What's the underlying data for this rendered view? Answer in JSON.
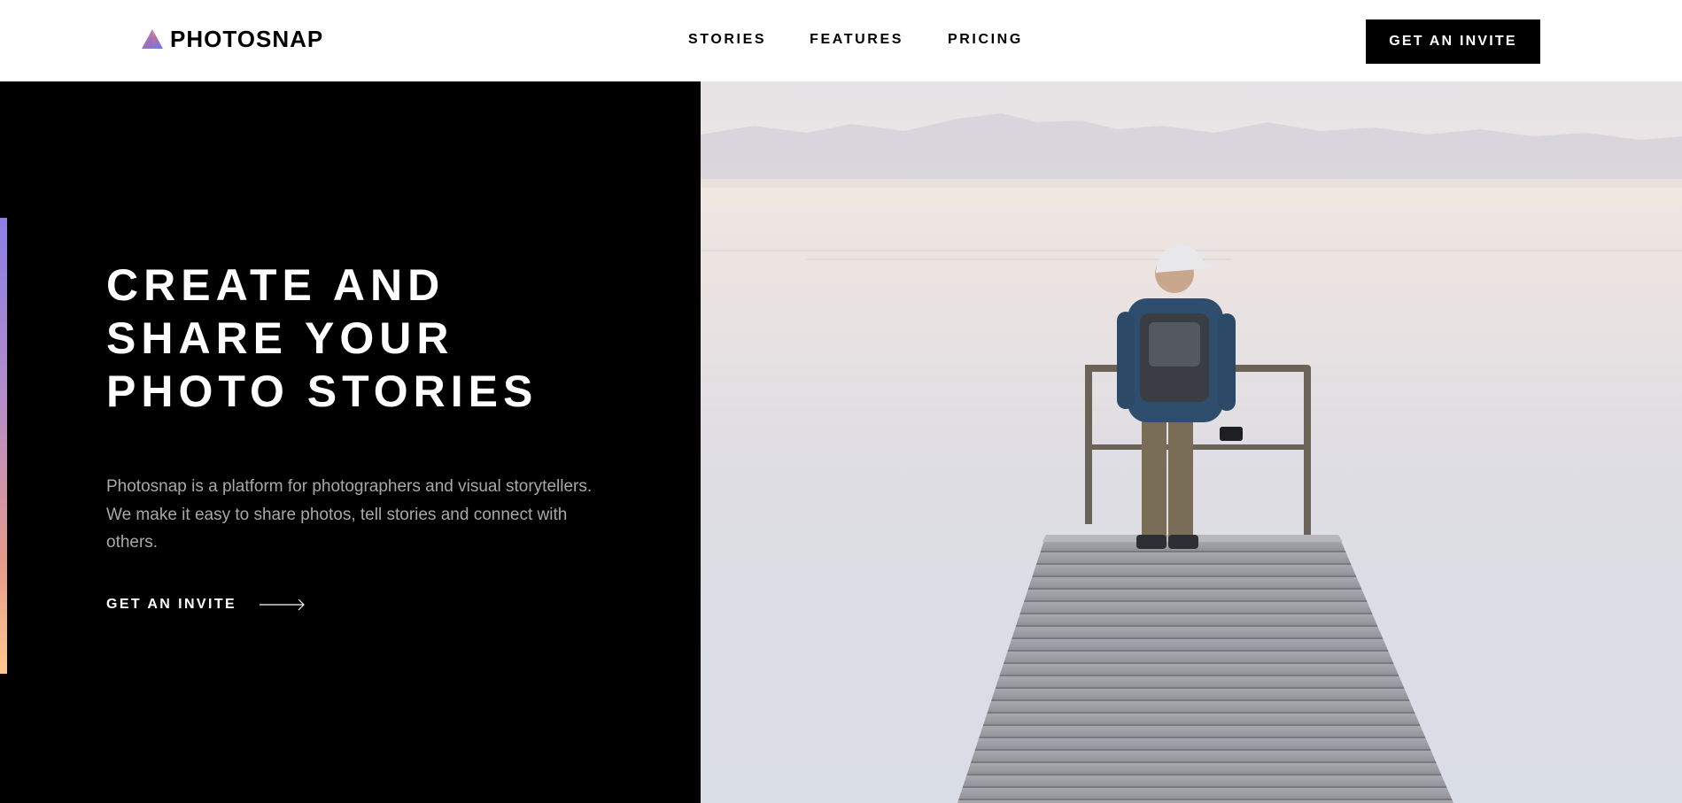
{
  "brand": {
    "name": "PHOTOSNAP",
    "logo_gradient": [
      "#ffc593",
      "#bc7198",
      "#5a77ff"
    ]
  },
  "nav": {
    "items": [
      {
        "label": "STORIES"
      },
      {
        "label": "FEATURES"
      },
      {
        "label": "PRICING"
      }
    ],
    "cta_label": "GET AN INVITE"
  },
  "hero": {
    "title_lines": [
      "CREATE AND",
      "SHARE YOUR",
      "PHOTO STORIES"
    ],
    "description": "Photosnap is a platform for photographers and visual storytellers. We make it easy to share photos, tell stories and connect with others.",
    "link_label": "GET AN INVITE",
    "link_icon": "arrow-right-icon",
    "image_subject": "",
    "colors": {
      "panel_bg": "#000000",
      "accent_gradient": [
        "#8b7fe6",
        "#e59a8c",
        "#fdc990"
      ],
      "text": "#ffffff",
      "muted_text": "#a8a8a8"
    }
  }
}
